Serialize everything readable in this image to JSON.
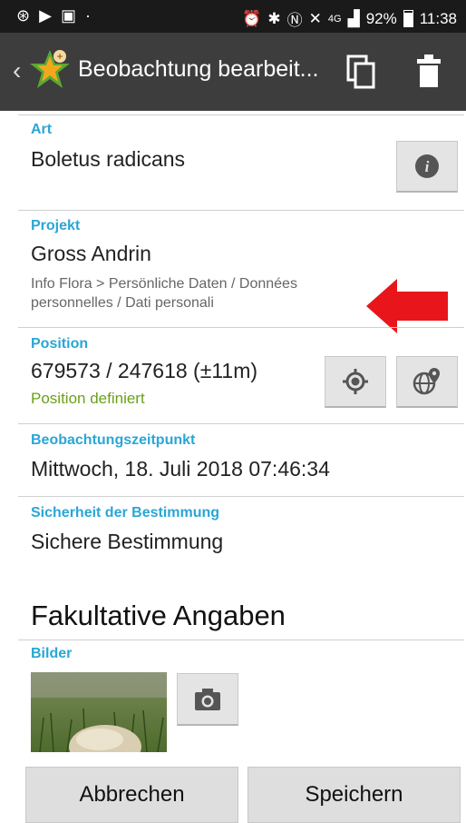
{
  "statusbar": {
    "network": "4G",
    "battery": "92%",
    "time": "11:38"
  },
  "appbar": {
    "title": "Beobachtung bearbeit..."
  },
  "art": {
    "label": "Art",
    "value": "Boletus radicans"
  },
  "projekt": {
    "label": "Projekt",
    "value": "Gross Andrin",
    "path": "Info Flora > Persönliche Daten / Données personnelles / Dati personali"
  },
  "position": {
    "label": "Position",
    "value": "679573 / 247618 (±11m)",
    "status": "Position definiert"
  },
  "zeitpunkt": {
    "label": "Beobachtungszeitpunkt",
    "value": "Mittwoch, 18. Juli 2018 07:46:34"
  },
  "sicherheit": {
    "label": "Sicherheit der Bestimmung",
    "value": "Sichere Bestimmung"
  },
  "fakultativ": {
    "heading": "Fakultative Angaben",
    "bilder_label": "Bilder"
  },
  "buttons": {
    "cancel": "Abbrechen",
    "save": "Speichern"
  },
  "colors": {
    "accent": "#2aa6d6",
    "ok": "#6aa01a",
    "annotation_arrow": "#e8161b"
  }
}
